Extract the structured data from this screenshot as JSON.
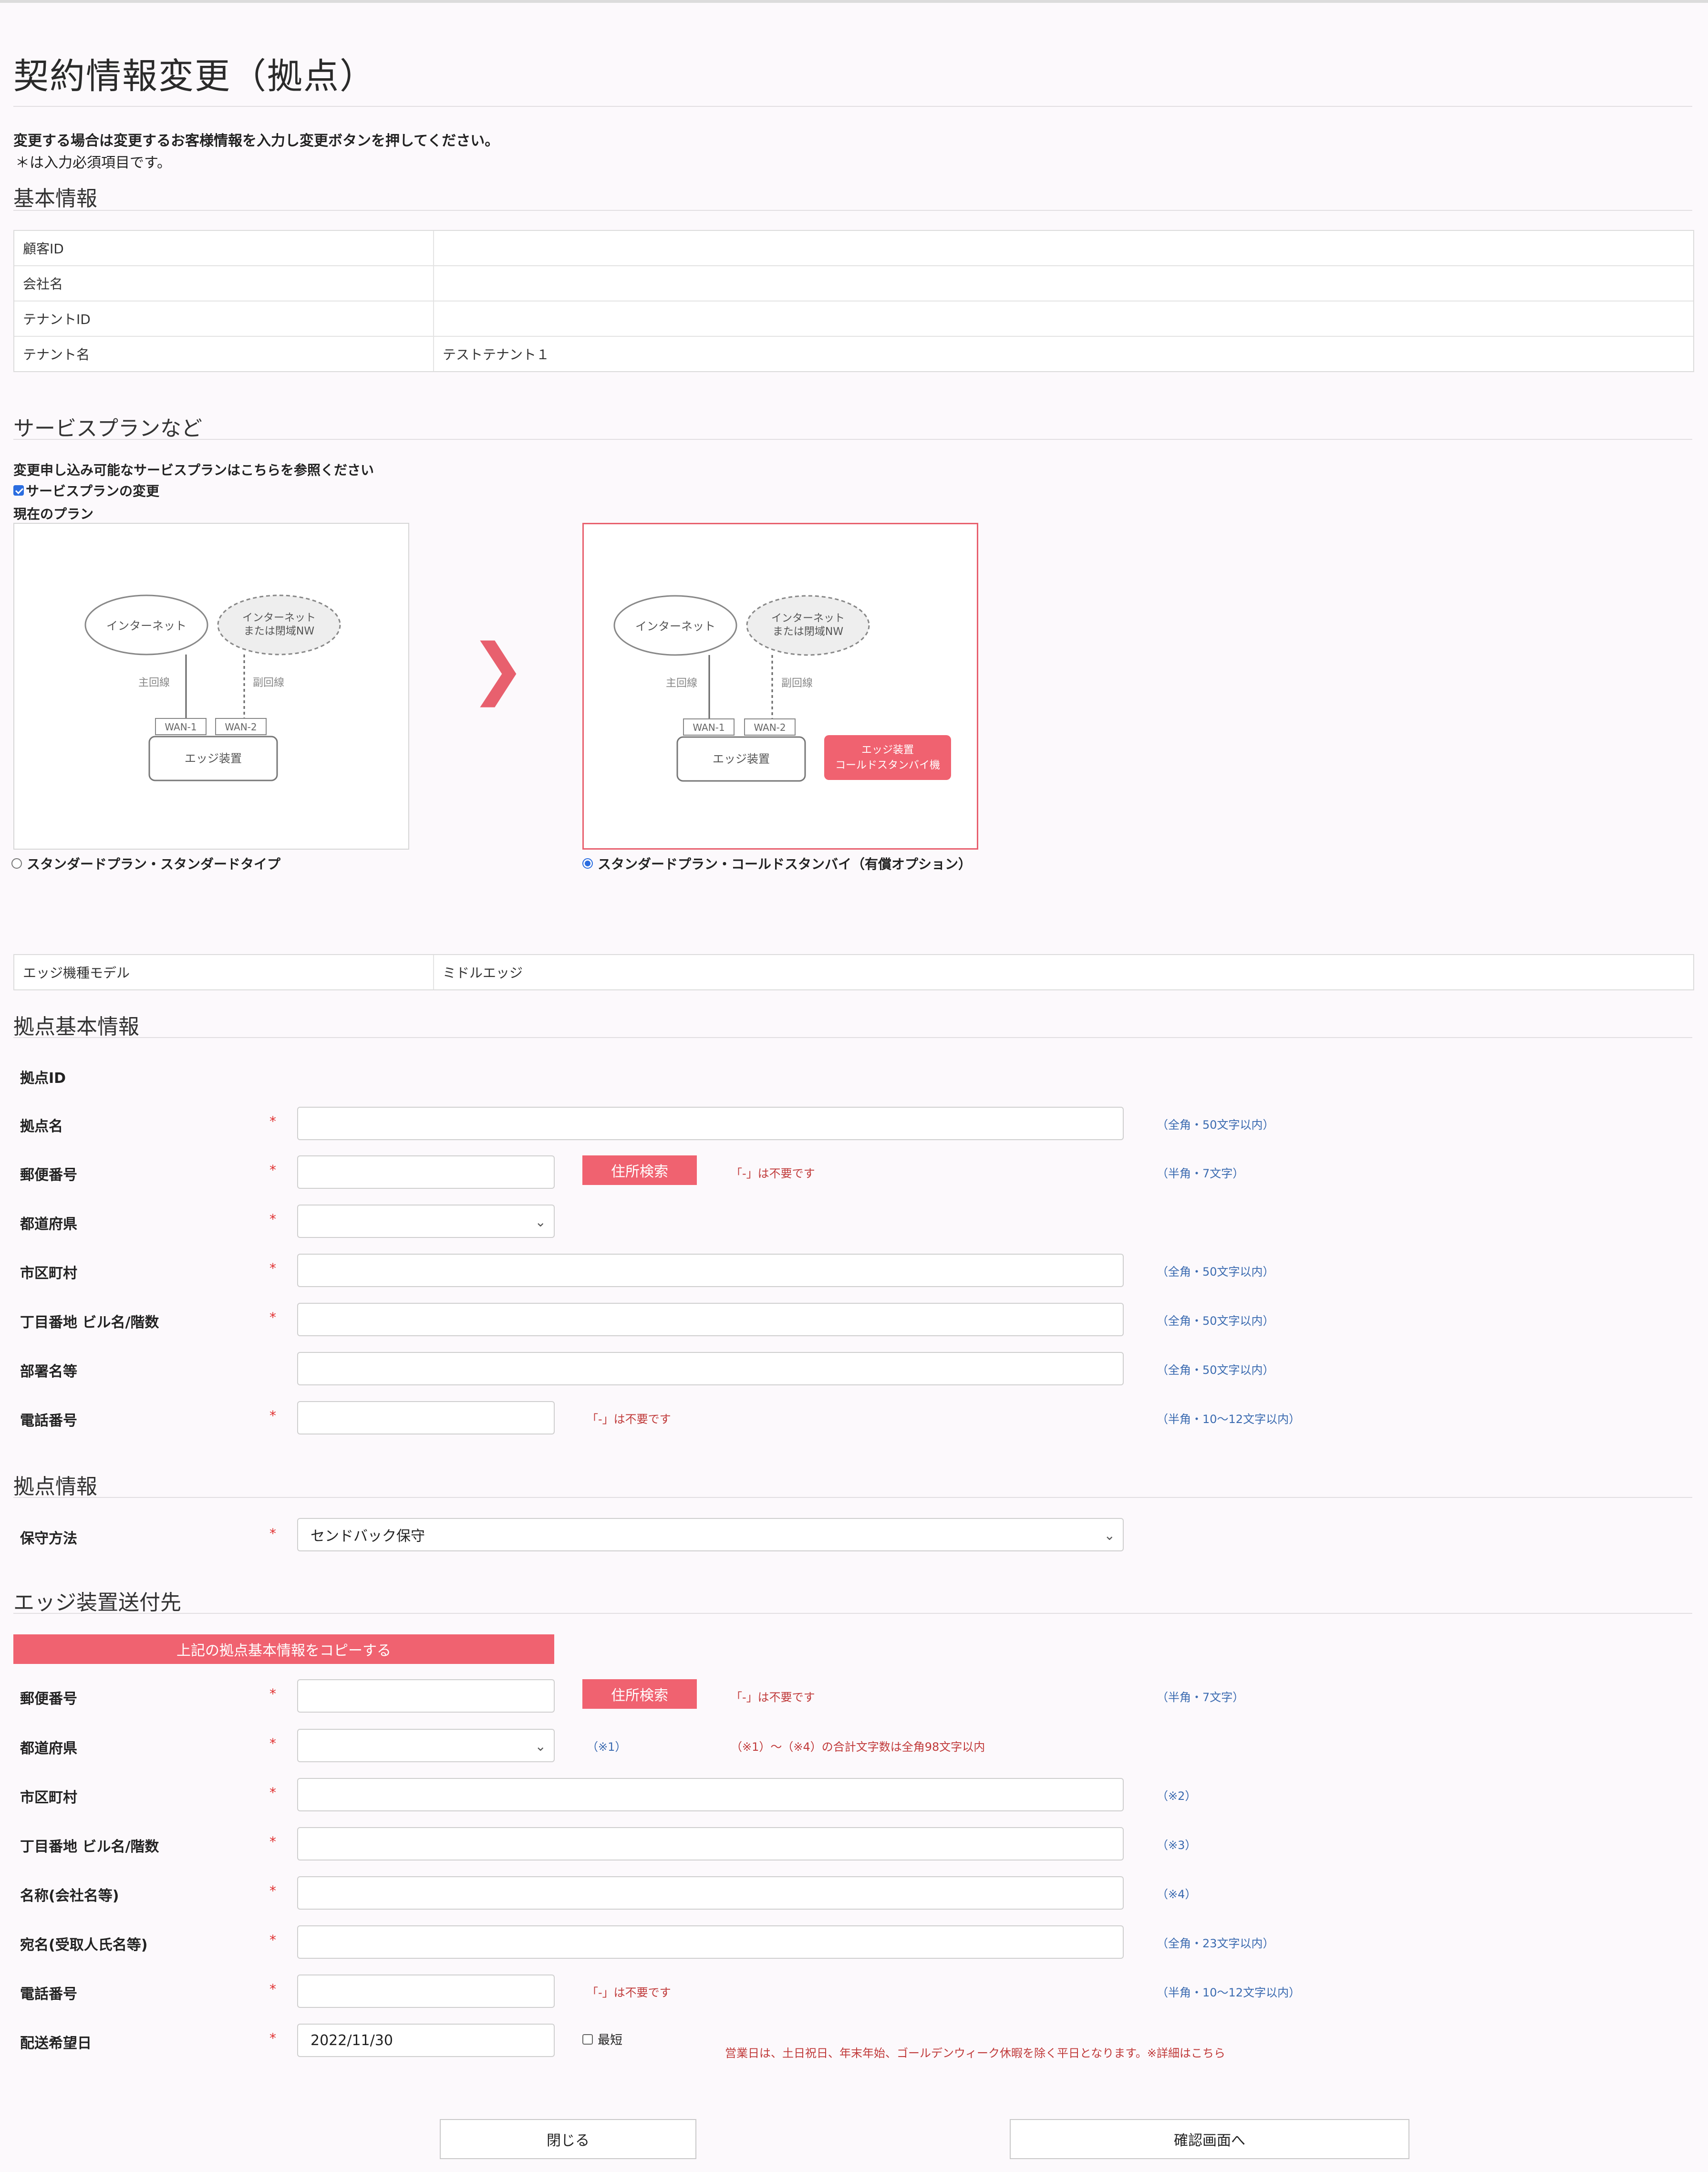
{
  "page": {
    "title": "契約情報変更（拠点）",
    "intro_bold": "変更する場合は変更するお客様情報を入力し変更ボタンを押してください。",
    "intro_note": "＊は入力必須項目です。"
  },
  "basic_info": {
    "title": "基本情報",
    "rows": [
      {
        "label": "顧客ID",
        "value": ""
      },
      {
        "label": "会社名",
        "value": ""
      },
      {
        "label": "テナントID",
        "value": ""
      },
      {
        "label": "テナント名",
        "value": "テストテナント１"
      }
    ]
  },
  "service_plan": {
    "title": "サービスプランなど",
    "reference_text": "変更申し込み可能なサービスプランはこちらを参照ください",
    "change_checkbox_label": "サービスプランの変更",
    "current_plan_label": "現在のプラン",
    "diagram": {
      "internet": "インターネット",
      "internet_or_closed_1": "インターネット",
      "internet_or_closed_2": "または閉域NW",
      "main_line": "主回線",
      "sub_line": "副回線",
      "wan1": "WAN-1",
      "wan2": "WAN-2",
      "edge_device": "エッジ装置",
      "standby_1": "エッジ装置",
      "standby_2": "コールドスタンバイ機"
    },
    "option_standard": "スタンダードプラン・スタンダードタイプ",
    "option_cold_standby": "スタンダードプラン・コールドスタンバイ（有償オプション）",
    "arrow": "❯",
    "edge_model_label": "エッジ機種モデル",
    "edge_model_value": "ミドルエッジ"
  },
  "site_basic": {
    "title": "拠点基本情報",
    "site_id_label": "拠点ID",
    "site_id_value": "",
    "required_mark": "*",
    "fields": {
      "site_name": {
        "label": "拠点名",
        "hint": "（全角・50文字以内）"
      },
      "postal": {
        "label": "郵便番号",
        "button": "住所検索",
        "warn": "「-」は不要です",
        "hint": "（半角・7文字）"
      },
      "prefecture": {
        "label": "都道府県"
      },
      "city": {
        "label": "市区町村",
        "hint": "（全角・50文字以内）"
      },
      "address": {
        "label": "丁目番地 ビル名/階数",
        "hint": "（全角・50文字以内）"
      },
      "dept": {
        "label": "部署名等",
        "hint": "（全角・50文字以内）"
      },
      "phone": {
        "label": "電話番号",
        "warn": "「-」は不要です",
        "hint": "（半角・10〜12文字以内）"
      }
    }
  },
  "site_info": {
    "title": "拠点情報",
    "maintenance_label": "保守方法",
    "maintenance_value": "センドバック保守"
  },
  "shipping": {
    "title": "エッジ装置送付先",
    "copy_button": "上記の拠点基本情報をコピーする",
    "fields": {
      "postal": {
        "label": "郵便番号",
        "button": "住所検索",
        "warn": "「-」は不要です",
        "hint": "（半角・7文字）"
      },
      "prefecture": {
        "label": "都道府県",
        "note": "（※1）",
        "warn": "（※1）〜（※4）の合計文字数は全角98文字以内"
      },
      "city": {
        "label": "市区町村",
        "note": "（※2）"
      },
      "address": {
        "label": "丁目番地 ビル名/階数",
        "note": "（※3）"
      },
      "company": {
        "label": "名称(会社名等)",
        "note": "（※4）"
      },
      "recipient": {
        "label": "宛名(受取人氏名等)",
        "hint": "（全角・23文字以内）"
      },
      "phone": {
        "label": "電話番号",
        "warn": "「-」は不要です",
        "hint": "（半角・10〜12文字以内）"
      },
      "delivery_date": {
        "label": "配送希望日",
        "value": "2022/11/30",
        "shortest": "最短",
        "note": "営業日は、土日祝日、年末年始、ゴールデンウィーク休暇を除く平日となります。※詳細はこちら"
      }
    }
  },
  "footer": {
    "close_button": "閉じる",
    "confirm_button": "確認画面へ"
  },
  "colors": {
    "accent": "#f06270",
    "hint_blue": "#3a6ab0",
    "warn_red": "#c03a3a"
  }
}
